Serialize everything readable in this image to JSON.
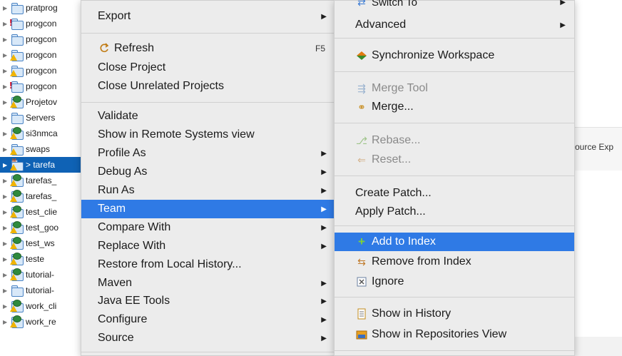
{
  "tree": {
    "items": [
      {
        "label": "pratprog",
        "icon": "folder"
      },
      {
        "label": "progcon",
        "icon": "folder-error"
      },
      {
        "label": "progcon",
        "icon": "folder"
      },
      {
        "label": "progcon",
        "icon": "folder-warning"
      },
      {
        "label": "progcon",
        "icon": "folder-warning"
      },
      {
        "label": "progcon",
        "icon": "folder-error"
      },
      {
        "label": "Projetov",
        "icon": "web-project"
      },
      {
        "label": "Servers",
        "icon": "folder"
      },
      {
        "label": "si3nmca",
        "icon": "web-project"
      },
      {
        "label": "swaps",
        "icon": "folder-warning"
      },
      {
        "label": "> tarefa",
        "icon": "maven-project"
      },
      {
        "label": "tarefas_",
        "icon": "web-project"
      },
      {
        "label": "tarefas_",
        "icon": "web-project"
      },
      {
        "label": "test_clie",
        "icon": "web-project"
      },
      {
        "label": "test_goo",
        "icon": "web-project"
      },
      {
        "label": "test_ws",
        "icon": "web-project"
      },
      {
        "label": "teste",
        "icon": "web-project"
      },
      {
        "label": "tutorial-",
        "icon": "web-project"
      },
      {
        "label": "tutorial-",
        "icon": "folder"
      },
      {
        "label": "work_cli",
        "icon": "web-project"
      },
      {
        "label": "work_re",
        "icon": "web-project"
      }
    ]
  },
  "context_menu": {
    "export": "Export",
    "refresh": "Refresh",
    "refresh_shortcut": "F5",
    "close_project": "Close Project",
    "close_unrelated": "Close Unrelated Projects",
    "validate": "Validate",
    "show_remote": "Show in Remote Systems view",
    "profile_as": "Profile As",
    "debug_as": "Debug As",
    "run_as": "Run As",
    "team": "Team",
    "compare_with": "Compare With",
    "replace_with": "Replace With",
    "restore_history": "Restore from Local History...",
    "maven": "Maven",
    "java_ee_tools": "Java EE Tools",
    "configure": "Configure",
    "source": "Source"
  },
  "team_menu": {
    "switch_to": "Switch To",
    "advanced": "Advanced",
    "synchronize": "Synchronize Workspace",
    "merge_tool": "Merge Tool",
    "merge": "Merge...",
    "rebase": "Rebase...",
    "reset": "Reset...",
    "create_patch": "Create Patch...",
    "apply_patch": "Apply Patch...",
    "add_to_index": "Add to Index",
    "remove_from_index": "Remove from Index",
    "ignore": "Ignore",
    "show_history": "Show in History",
    "show_repositories": "Show in Repositories View"
  },
  "background": {
    "partial_label": "ource Exp"
  },
  "colors": {
    "highlight": "#2f7ae5",
    "tree_selection": "#0f62b5",
    "menu_bg": "#ececec"
  }
}
